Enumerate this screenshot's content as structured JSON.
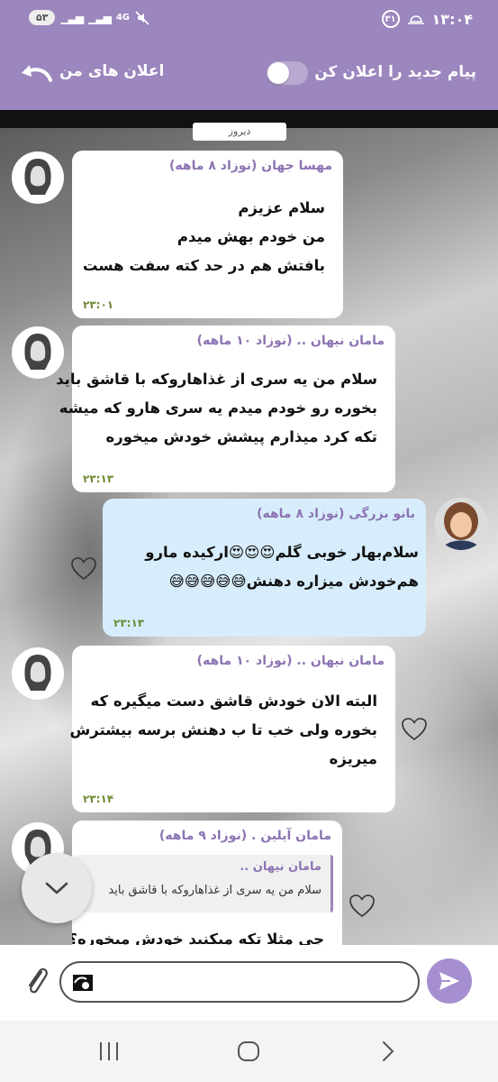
{
  "status_bar": {
    "time": "۱۳:۰۴",
    "calendar_badge": "۳۱",
    "battery": "۵۳",
    "network": "4G"
  },
  "header": {
    "notify_label": "پیام جدید را اعلان کن",
    "title": "اعلان های من",
    "toggle_on": false
  },
  "chat": {
    "date_divider": "دیروز",
    "messages": [
      {
        "sender": "مهسا جهان (نوزاد ۸ ماهه)",
        "lines": [
          "سلام عزیزم",
          "من خودم بهش میدم",
          "بافتش هم در حد کته سفت هست"
        ],
        "time": "۲۳:۰۱"
      },
      {
        "sender": "مامان نیهان .. (نوزاد ۱۰ ماهه)",
        "lines": [
          "سلام من یه سری از غذاهاروکه با قاشق باید",
          "بخوره رو خودم میدم یه سری هارو که میشه",
          "تکه کرد میذارم پیشش خودش میخوره"
        ],
        "time": "۲۳:۱۳"
      },
      {
        "sender": "بانو بزرگی (نوزاد ۸ ماهه)",
        "lines": [
          "سلام‌بهار خوبی گلم😍😍😍ارکیده مارو",
          "هم‌خودش میزاره دهنش😅😅😅😅😅"
        ],
        "time": "۲۳:۱۳"
      },
      {
        "sender": "مامان نیهان .. (نوزاد ۱۰ ماهه)",
        "lines": [
          "البته الان خودش قاشق دست میگیره که",
          "بخوره ولی خب تا ب دهنش برسه بیشترش",
          "میریزه"
        ],
        "time": "۲۳:۱۴"
      },
      {
        "sender": "مامان آیلین . (نوزاد ۹ ماهه)",
        "reply_name": "مامان نیهان ..",
        "reply_text": "سلام من یه سری از غذاهاروکه با قاشق باید",
        "lines": [
          "چی مثلا تکه میکنید خودش میخوره؟"
        ]
      }
    ]
  },
  "input": {
    "placeholder": ""
  },
  "colors": {
    "header": "#9b86bd",
    "sender_name": "#8c74b3",
    "time": "#6d8a34",
    "own_bubble": "#d7edfb",
    "send_button": "#a68fd0"
  },
  "icons": [
    "back-arrow-icon",
    "toggle-switch",
    "heart-icon",
    "scroll-down-icon",
    "attach-icon",
    "emoji-icon",
    "send-icon",
    "recents-icon",
    "home-icon",
    "back-nav-icon"
  ]
}
